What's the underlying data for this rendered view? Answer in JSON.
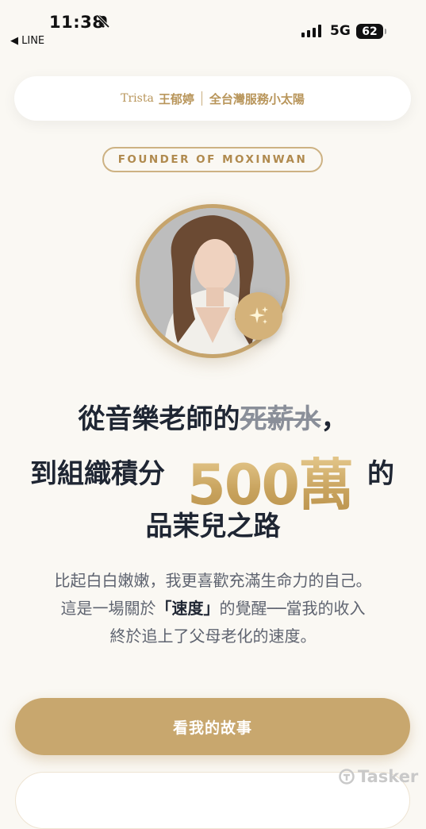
{
  "status_bar": {
    "time": "11:38",
    "back_app": "◀ LINE",
    "network": "5G",
    "battery": "62"
  },
  "name_pill": {
    "english_name": "Trista",
    "chinese_name": "王郁婷",
    "tagline": "全台灣服務小太陽"
  },
  "badge": {
    "label": "FOUNDER OF MOXINWAN"
  },
  "avatar": {
    "sparkle_icon": "sparkle-icon"
  },
  "headline": {
    "line1_a": "從音樂老師的",
    "line1_strike": "死薪水",
    "line1_b": "，",
    "line2_a": "到組織積分",
    "line2_number": "500萬",
    "line2_b": "的",
    "line3": "品茉兒之路"
  },
  "description": {
    "line1": "比起白白嫩嫩，我更喜歡充滿生命力的自己。",
    "line2_a": "這是一場關於",
    "line2_bold": "「速度」",
    "line2_b": "的覺醒──當我的收入",
    "line3": "終於追上了父母老化的速度。"
  },
  "cta": {
    "primary_label": "看我的故事"
  },
  "watermark": {
    "label": "Tasker"
  },
  "colors": {
    "accent_gold": "#c8a76e",
    "background": "#faf8f3",
    "headline": "#1f2633"
  }
}
